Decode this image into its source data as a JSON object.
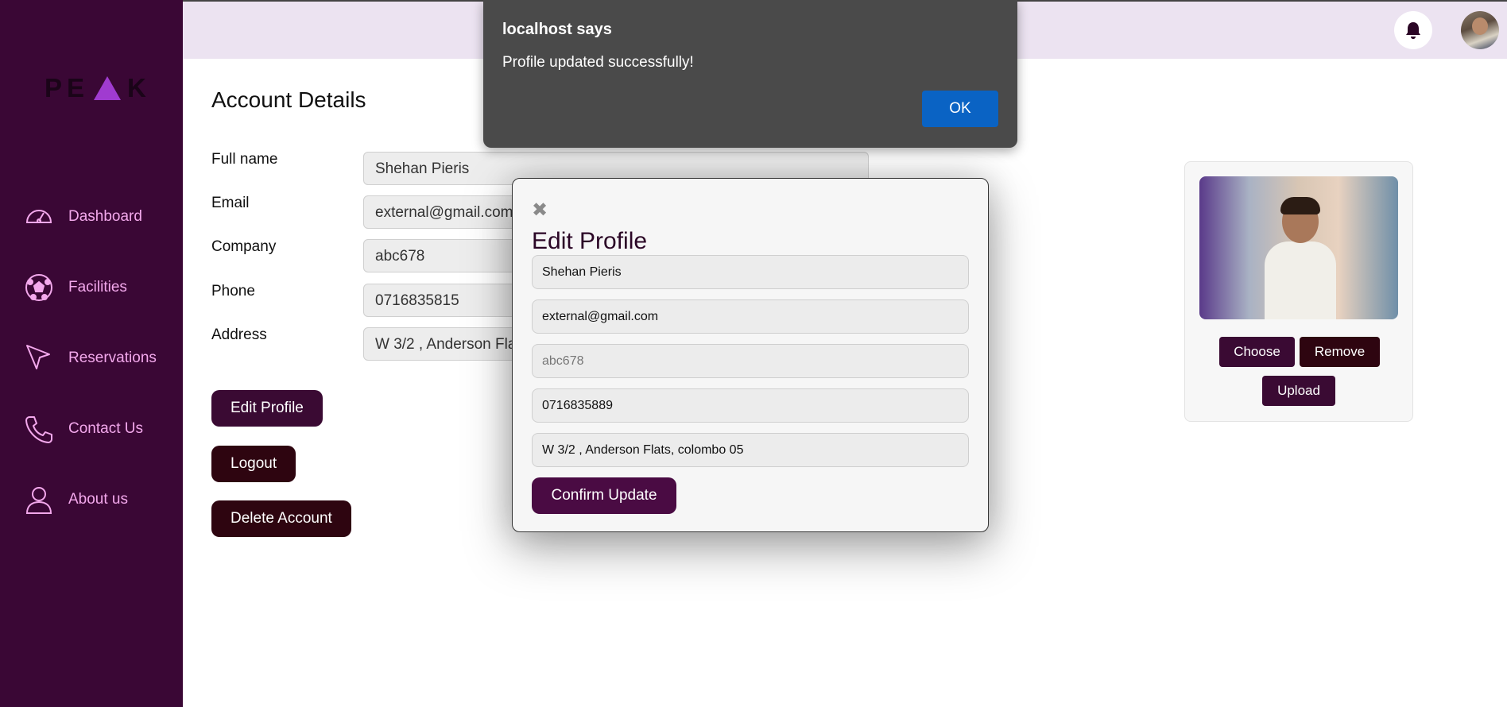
{
  "sidebar": {
    "logo": {
      "left": "PE",
      "right": "K"
    },
    "items": [
      {
        "label": "Dashboard",
        "icon": "gauge-icon"
      },
      {
        "label": "Facilities",
        "icon": "soccer-ball-icon"
      },
      {
        "label": "Reservations",
        "icon": "cursor-arrow-icon"
      },
      {
        "label": "Contact Us",
        "icon": "phone-icon"
      },
      {
        "label": "About us",
        "icon": "user-icon"
      }
    ]
  },
  "topbar": {
    "notification_icon": "bell-icon",
    "avatar_icon": "avatar-icon"
  },
  "account": {
    "title": "Account Details",
    "fields": [
      {
        "label": "Full name",
        "value": "Shehan Pieris"
      },
      {
        "label": "Email",
        "value": "external@gmail.com"
      },
      {
        "label": "Company",
        "value": "abc678"
      },
      {
        "label": "Phone",
        "value": "0716835815"
      },
      {
        "label": "Address",
        "value": "W 3/2 , Anderson Flats, colombo 05"
      }
    ],
    "edit_label": "Edit Profile",
    "logout_label": "Logout",
    "delete_label": "Delete Account"
  },
  "photo_card": {
    "choose_label": "Choose",
    "remove_label": "Remove",
    "upload_label": "Upload"
  },
  "modal": {
    "close_glyph": "✖",
    "title": "Edit Profile",
    "name_value": "Shehan Pieris",
    "email_value": "external@gmail.com",
    "company_placeholder": "abc678",
    "phone_value": "0716835889",
    "address_value": "W 3/2 , Anderson Flats, colombo 05",
    "confirm_label": "Confirm Update"
  },
  "alert": {
    "title": "localhost says",
    "message": "Profile updated successfully!",
    "ok_label": "OK"
  },
  "colors": {
    "sidebar_bg": "#3a0735",
    "nav_text": "#f3a8ec",
    "topbar_bg": "#ece3f1",
    "primary_button": "#3a0a33",
    "dark_button": "#2e0510",
    "alert_ok": "#0a63c4"
  }
}
